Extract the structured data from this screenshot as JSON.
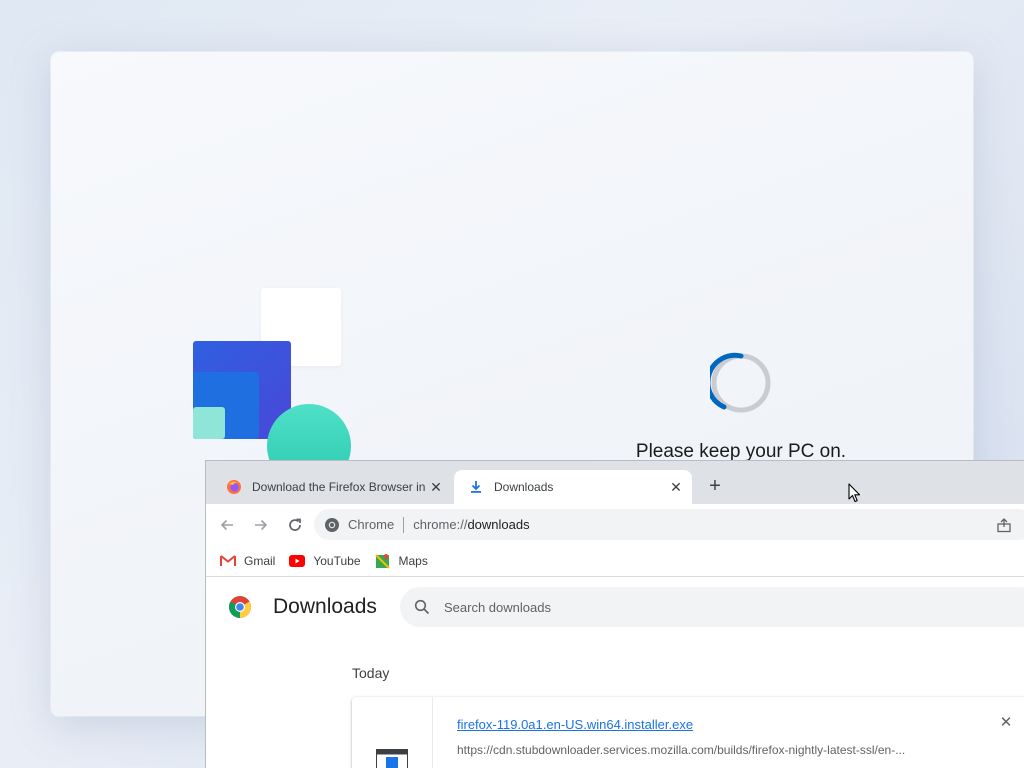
{
  "oobe": {
    "status_text": "Please keep your PC on."
  },
  "browser": {
    "tabs": [
      {
        "label": "Download the Firefox Browser in",
        "icon": "firefox-icon",
        "active": false
      },
      {
        "label": "Downloads",
        "icon": "download-icon",
        "active": true
      }
    ],
    "new_tab_label": "+",
    "tab_close_label": "✕",
    "omnibox": {
      "chip_label": "Chrome",
      "url_scheme": "chrome://",
      "url_path": "downloads"
    },
    "bookmarks": [
      {
        "label": "Gmail",
        "icon": "gmail-icon"
      },
      {
        "label": "YouTube",
        "icon": "youtube-icon"
      },
      {
        "label": "Maps",
        "icon": "maps-icon"
      }
    ]
  },
  "downloads_page": {
    "title": "Downloads",
    "search_placeholder": "Search downloads",
    "section_date": "Today",
    "items": [
      {
        "file_name": "firefox-119.0a1.en-US.win64.installer.exe",
        "url": "https://cdn.stubdownloader.services.mozilla.com/builds/firefox-nightly-latest-ssl/en-...",
        "remove_label": "✕"
      }
    ]
  },
  "colors": {
    "link": "#1a73e8",
    "tabstrip": "#dee1e6",
    "spinner": "#0067c0",
    "logo_blue": "#2f5fe0",
    "logo_mint": "#2bc9b0"
  }
}
